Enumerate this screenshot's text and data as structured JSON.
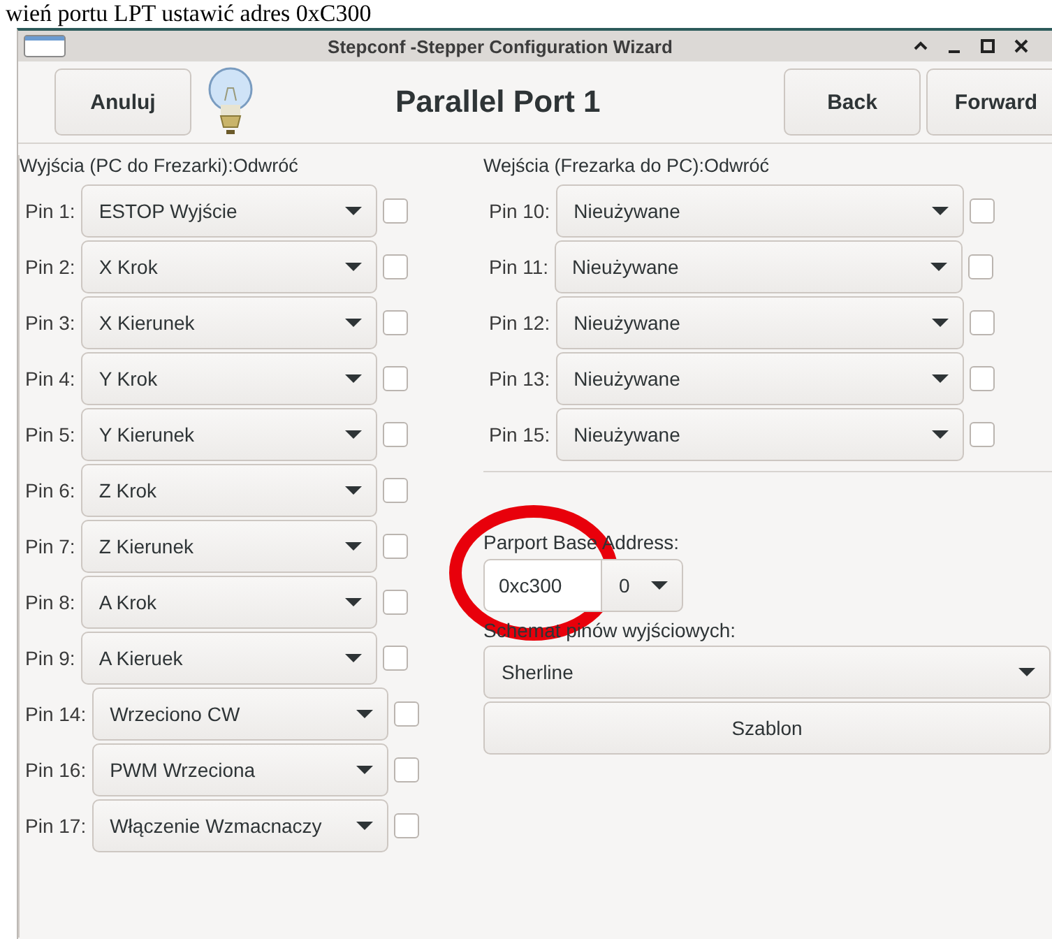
{
  "caption": "wień portu LPT ustawić adres 0xC300",
  "window": {
    "title": "Stepconf -Stepper Configuration Wizard"
  },
  "header": {
    "cancel": "Anuluj",
    "title": "Parallel Port 1",
    "back": "Back",
    "forward": "Forward"
  },
  "outputs": {
    "heading": "Wyjścia (PC do Frezarki):Odwróć",
    "pins": [
      {
        "label": "Pin 1:",
        "value": "ESTOP Wyjście",
        "checked": false
      },
      {
        "label": "Pin 2:",
        "value": "X Krok",
        "checked": false
      },
      {
        "label": "Pin 3:",
        "value": "X Kierunek",
        "checked": false
      },
      {
        "label": "Pin 4:",
        "value": "Y Krok",
        "checked": false
      },
      {
        "label": "Pin 5:",
        "value": "Y Kierunek",
        "checked": false
      },
      {
        "label": "Pin 6:",
        "value": "Z Krok",
        "checked": false
      },
      {
        "label": "Pin 7:",
        "value": "Z Kierunek",
        "checked": false
      },
      {
        "label": "Pin 8:",
        "value": "A Krok",
        "checked": false
      },
      {
        "label": "Pin 9:",
        "value": "A Kieruek",
        "checked": false
      },
      {
        "label": "Pin 14:",
        "value": "Wrzeciono CW",
        "checked": false
      },
      {
        "label": "Pin 16:",
        "value": "PWM Wrzeciona",
        "checked": false
      },
      {
        "label": "Pin 17:",
        "value": "Włączenie Wzmacnaczy",
        "checked": false
      }
    ]
  },
  "inputs": {
    "heading": "Wejścia (Frezarka do PC):Odwróć",
    "pins": [
      {
        "label": "Pin 10:",
        "value": "Nieużywane",
        "checked": false
      },
      {
        "label": "Pin 11:",
        "value": "Nieużywane",
        "checked": false
      },
      {
        "label": "Pin 12:",
        "value": "Nieużywane",
        "checked": false
      },
      {
        "label": "Pin 13:",
        "value": "Nieużywane",
        "checked": false
      },
      {
        "label": "Pin 15:",
        "value": "Nieużywane",
        "checked": false
      }
    ]
  },
  "parport": {
    "label": "Parport Base Address:",
    "address": "0xc300",
    "index": "0"
  },
  "output_scheme": {
    "label": "Schemat pinów wyjściowych:",
    "value": "Sherline",
    "button": "Szablon"
  }
}
